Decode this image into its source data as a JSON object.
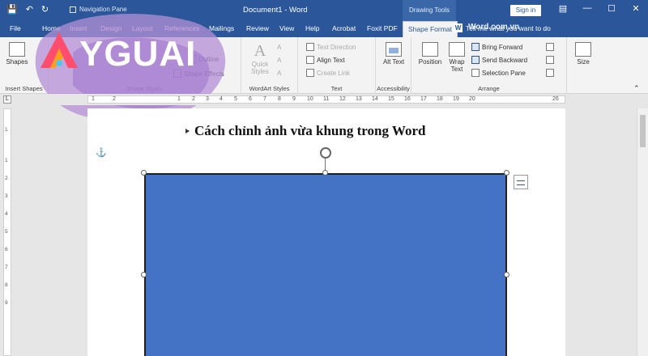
{
  "title_bar": {
    "nav_pane_label": "Navigation Pane",
    "document_title": "Document1  -  Word",
    "context_group": "Drawing Tools",
    "sign_in": "Sign in"
  },
  "tabs": [
    {
      "label": "File"
    },
    {
      "label": "Home"
    },
    {
      "label": "Insert"
    },
    {
      "label": "Design"
    },
    {
      "label": "Layout"
    },
    {
      "label": "References"
    },
    {
      "label": "Mailings"
    },
    {
      "label": "Review"
    },
    {
      "label": "View"
    },
    {
      "label": "Help"
    },
    {
      "label": "Acrobat"
    },
    {
      "label": "Foxit PDF"
    },
    {
      "label": "Shape Format",
      "active": true
    }
  ],
  "tell_me": "Tell me what you want to do",
  "tell_me_icon": "W",
  "ribbon": {
    "insert_shapes": {
      "shapes_label": "Shapes",
      "group_label": "Insert Shapes"
    },
    "shape_styles": {
      "outline_label": "Outline",
      "effects_label": "Shape Effects",
      "group_label": "Shape Styles"
    },
    "wordart_styles": {
      "quick_styles_label": "Quick Styles",
      "group_label": "WordArt Styles"
    },
    "text": {
      "text_direction_label": "Text Direction",
      "align_text_label": "Align Text",
      "create_link_label": "Create Link",
      "group_label": "Text"
    },
    "accessibility": {
      "alt_text_label": "Alt Text",
      "group_label": "Accessibility"
    },
    "arrange": {
      "position_label": "Position",
      "wrap_text_label": "Wrap Text",
      "bring_forward_label": "Bring Forward",
      "send_backward_label": "Send Backward",
      "selection_pane_label": "Selection Pane",
      "group_label": "Arrange"
    },
    "size": {
      "size_label": "Size"
    }
  },
  "watermark": {
    "logo_text": "YGUAI",
    "overlay_text": "Word.com.vn"
  },
  "ruler": {
    "h_ticks": [
      "1",
      "2",
      "1",
      "2",
      "3",
      "4",
      "5",
      "6",
      "7",
      "8",
      "9",
      "10",
      "11",
      "12",
      "13",
      "14",
      "15",
      "16",
      "17",
      "18",
      "19",
      "20"
    ],
    "last_tick": "26",
    "v_ticks": [
      "1",
      "1",
      "2",
      "3",
      "4",
      "5",
      "6",
      "7",
      "8",
      "9"
    ]
  },
  "document": {
    "heading": "Cách chỉnh ảnh vừa khung trong Word",
    "shape_fill": "#4472c4"
  },
  "colors": {
    "brand": "#2b579a",
    "ribbon_bg": "#f3f3f3",
    "shape": "#4472c4"
  }
}
